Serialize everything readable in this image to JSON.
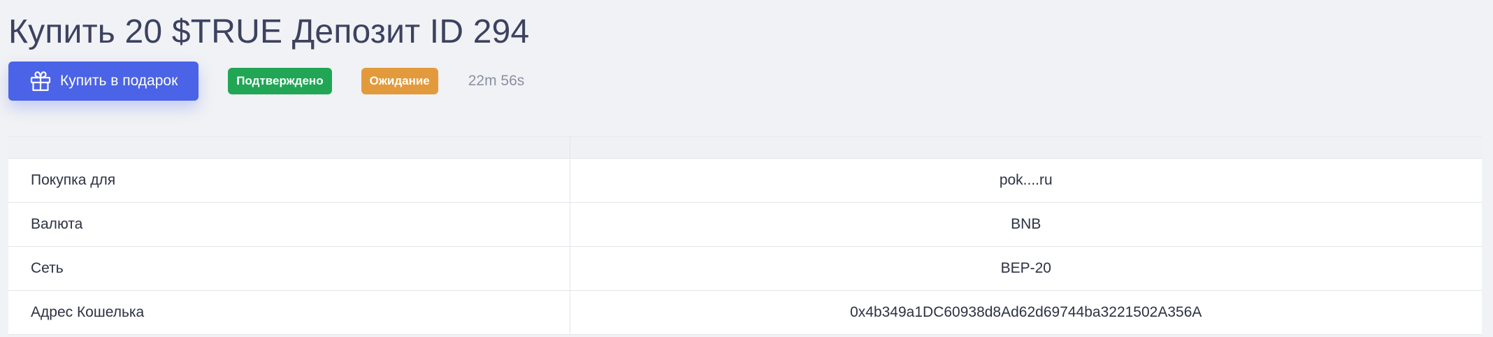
{
  "page": {
    "title": "Купить 20 $TRUE Депозит ID 294"
  },
  "actions": {
    "gift_button_label": "Купить в подарок",
    "gift_icon": "gift-icon",
    "status_confirmed": "Подтверждено",
    "status_pending": "Ожидание",
    "timer": "22m 56s"
  },
  "colors": {
    "primary": "#4b63e6",
    "success": "#21a655",
    "warning": "#e39a3c"
  },
  "details": {
    "rows": [
      {
        "label": "Покупка для",
        "value": "pok....ru"
      },
      {
        "label": "Валюта",
        "value": "BNB"
      },
      {
        "label": "Сеть",
        "value": "BEP-20"
      },
      {
        "label": "Адрес Кошелька",
        "value": "0x4b349a1DC60938d8Ad62d69744ba3221502A356A"
      }
    ]
  }
}
